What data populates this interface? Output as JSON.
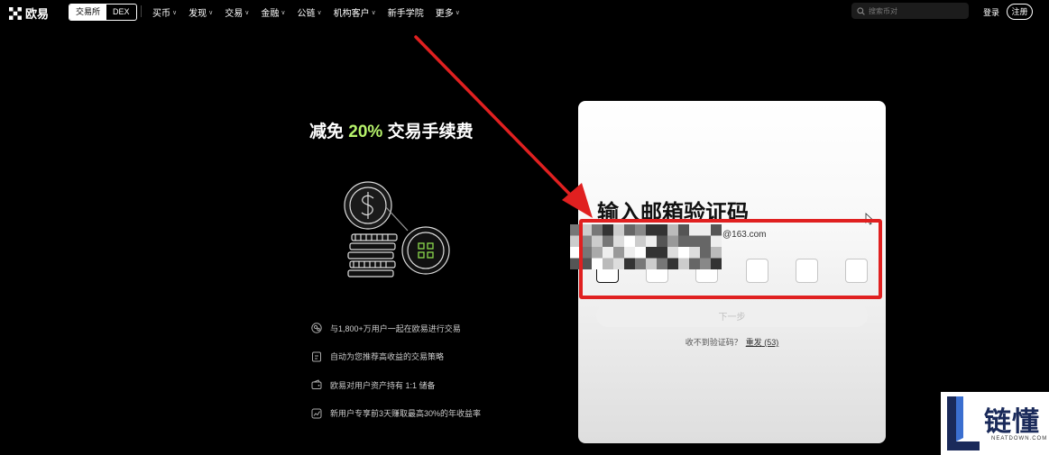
{
  "nav": {
    "brand": "欧易",
    "mode_toggle": {
      "active": "交易所",
      "inactive": "DEX"
    },
    "menu": [
      "买币",
      "发现",
      "交易",
      "金融",
      "公链",
      "机构客户",
      "新手学院",
      "更多"
    ],
    "menu_has_dropdown": [
      true,
      true,
      true,
      true,
      true,
      true,
      false,
      true
    ],
    "search_placeholder": "搜索币对",
    "login_label": "登录",
    "register_label": "注册"
  },
  "promo": {
    "headline_prefix": "减免",
    "headline_highlight": "20%",
    "headline_suffix": "交易手续费",
    "benefits": [
      {
        "icon": "users-icon",
        "text": "与1,800+万用户一起在欧易进行交易"
      },
      {
        "icon": "strategy-icon",
        "text": "自动为您推荐高收益的交易策略"
      },
      {
        "icon": "wallet-icon",
        "text": "欧易对用户资产持有 1:1 储备"
      },
      {
        "icon": "chart-icon",
        "text": "新用户专享前3天赚取最高30%的年收益率"
      }
    ]
  },
  "verify": {
    "title": "输入邮箱验证码",
    "email_domain": "@163.com",
    "code_box_count": 6,
    "next_button": "下一步",
    "resend_prompt": "收不到验证码？",
    "resend_label": "重发",
    "resend_countdown": "(53)"
  },
  "watermark": {
    "text": "链懂",
    "sub": "NEATDOWN.COM"
  },
  "colors": {
    "background": "#000000",
    "accent_green": "#b6f26b",
    "annotation_red": "#e02020",
    "card_bg": "#ffffff"
  }
}
